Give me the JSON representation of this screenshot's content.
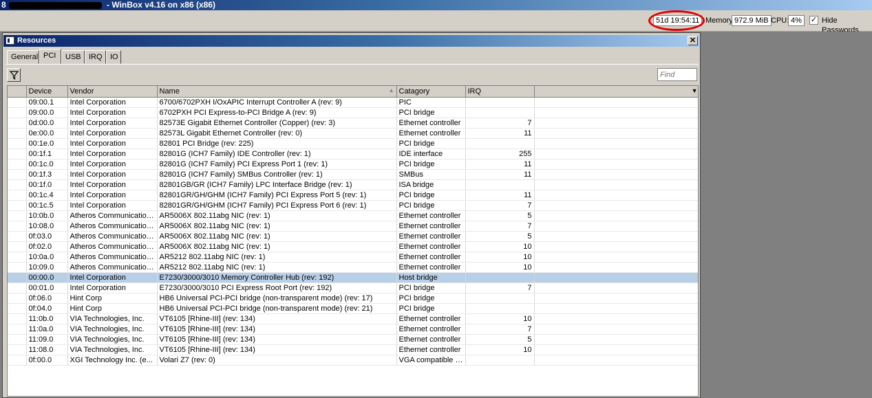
{
  "app": {
    "title_prefix": "8",
    "title": " - WinBox v4.16 on x86 (x86)"
  },
  "status": {
    "uptime": "51d 19:54:11",
    "memory_label": "Memory:",
    "memory_value": "972.9 MiB",
    "cpu_label": "CPU:",
    "cpu_value": "4%",
    "hide_passwords_label": "Hide Passwords",
    "hide_passwords_checked": "✓"
  },
  "window": {
    "title": "Resources",
    "close": "✕"
  },
  "tabs": [
    {
      "label": "General"
    },
    {
      "label": "PCI"
    },
    {
      "label": "USB"
    },
    {
      "label": "IRQ"
    },
    {
      "label": "IO"
    }
  ],
  "toolbar": {
    "find_placeholder": "Find"
  },
  "table": {
    "columns": [
      "Device",
      "Vendor",
      "Name",
      "Catagory",
      "IRQ"
    ],
    "rows": [
      [
        "09:00.1",
        "Intel Corporation",
        "6700/6702PXH I/OxAPIC Interrupt Controller A (rev: 9)",
        "PIC",
        ""
      ],
      [
        "09:00.0",
        "Intel Corporation",
        "6702PXH PCI Express-to-PCI Bridge A (rev: 9)",
        "PCI bridge",
        ""
      ],
      [
        "0d:00.0",
        "Intel Corporation",
        "82573E Gigabit Ethernet Controller (Copper) (rev: 3)",
        "Ethernet controller",
        "7"
      ],
      [
        "0e:00.0",
        "Intel Corporation",
        "82573L Gigabit Ethernet Controller (rev: 0)",
        "Ethernet controller",
        "11"
      ],
      [
        "00:1e.0",
        "Intel Corporation",
        "82801 PCI Bridge (rev: 225)",
        "PCI bridge",
        ""
      ],
      [
        "00:1f.1",
        "Intel Corporation",
        "82801G (ICH7 Family) IDE Controller (rev: 1)",
        "IDE interface",
        "255"
      ],
      [
        "00:1c.0",
        "Intel Corporation",
        "82801G (ICH7 Family) PCI Express Port 1 (rev: 1)",
        "PCI bridge",
        "11"
      ],
      [
        "00:1f.3",
        "Intel Corporation",
        "82801G (ICH7 Family) SMBus Controller (rev: 1)",
        "SMBus",
        "11"
      ],
      [
        "00:1f.0",
        "Intel Corporation",
        "82801GB/GR (ICH7 Family) LPC Interface Bridge (rev: 1)",
        "ISA bridge",
        ""
      ],
      [
        "00:1c.4",
        "Intel Corporation",
        "82801GR/GH/GHM (ICH7 Family) PCI Express Port 5 (rev: 1)",
        "PCI bridge",
        "11"
      ],
      [
        "00:1c.5",
        "Intel Corporation",
        "82801GR/GH/GHM (ICH7 Family) PCI Express Port 6 (rev: 1)",
        "PCI bridge",
        "7"
      ],
      [
        "10:0b.0",
        "Atheros Communications...",
        "AR5006X 802.11abg NIC (rev: 1)",
        "Ethernet controller",
        "5"
      ],
      [
        "10:08.0",
        "Atheros Communications...",
        "AR5006X 802.11abg NIC (rev: 1)",
        "Ethernet controller",
        "7"
      ],
      [
        "0f:03.0",
        "Atheros Communications...",
        "AR5006X 802.11abg NIC (rev: 1)",
        "Ethernet controller",
        "5"
      ],
      [
        "0f:02.0",
        "Atheros Communications...",
        "AR5006X 802.11abg NIC (rev: 1)",
        "Ethernet controller",
        "10"
      ],
      [
        "10:0a.0",
        "Atheros Communications...",
        "AR5212 802.11abg NIC (rev: 1)",
        "Ethernet controller",
        "10"
      ],
      [
        "10:09.0",
        "Atheros Communications...",
        "AR5212 802.11abg NIC (rev: 1)",
        "Ethernet controller",
        "10"
      ],
      [
        "00:00.0",
        "Intel Corporation",
        "E7230/3000/3010 Memory Controller Hub (rev: 192)",
        "Host bridge",
        ""
      ],
      [
        "00:01.0",
        "Intel Corporation",
        "E7230/3000/3010 PCI Express Root Port (rev: 192)",
        "PCI bridge",
        "7"
      ],
      [
        "0f:06.0",
        "Hint Corp",
        "HB6 Universal PCI-PCI bridge (non-transparent mode) (rev: 17)",
        "PCI bridge",
        ""
      ],
      [
        "0f:04.0",
        "Hint Corp",
        "HB6 Universal PCI-PCI bridge (non-transparent mode) (rev: 21)",
        "PCI bridge",
        ""
      ],
      [
        "11:0b.0",
        "VIA Technologies, Inc.",
        "VT6105 [Rhine-III] (rev: 134)",
        "Ethernet controller",
        "10"
      ],
      [
        "11:0a.0",
        "VIA Technologies, Inc.",
        "VT6105 [Rhine-III] (rev: 134)",
        "Ethernet controller",
        "7"
      ],
      [
        "11:09.0",
        "VIA Technologies, Inc.",
        "VT6105 [Rhine-III] (rev: 134)",
        "Ethernet controller",
        "5"
      ],
      [
        "11:08.0",
        "VIA Technologies, Inc.",
        "VT6105 [Rhine-III] (rev: 134)",
        "Ethernet controller",
        "10"
      ],
      [
        "0f:00.0",
        "XGI Technology Inc. (e...",
        "Volari Z7 (rev: 0)",
        "VGA compatible c...",
        ""
      ]
    ],
    "selected_row": 17
  }
}
